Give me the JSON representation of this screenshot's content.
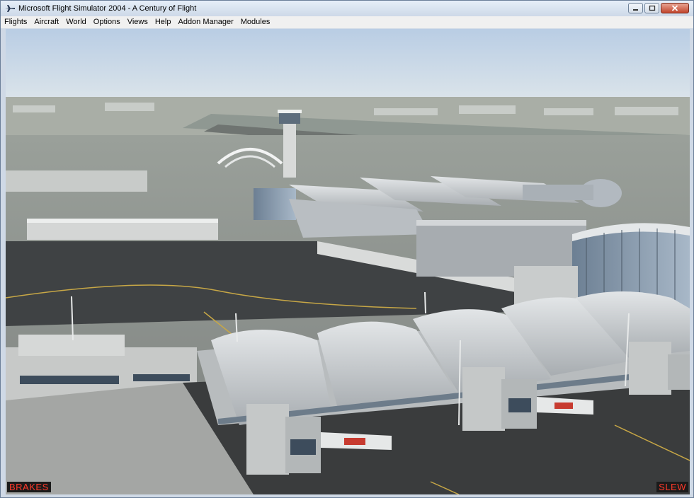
{
  "window": {
    "title": "Microsoft Flight Simulator 2004 - A Century of Flight",
    "icon": "airplane-icon"
  },
  "menu": {
    "items": [
      "Flights",
      "Aircraft",
      "World",
      "Options",
      "Views",
      "Help",
      "Addon Manager",
      "Modules"
    ]
  },
  "viewport": {
    "scene": "aerial-airport-terminal",
    "status_left": "BRAKES",
    "status_right": "SLEW",
    "status_color": "#ff3a2a"
  }
}
